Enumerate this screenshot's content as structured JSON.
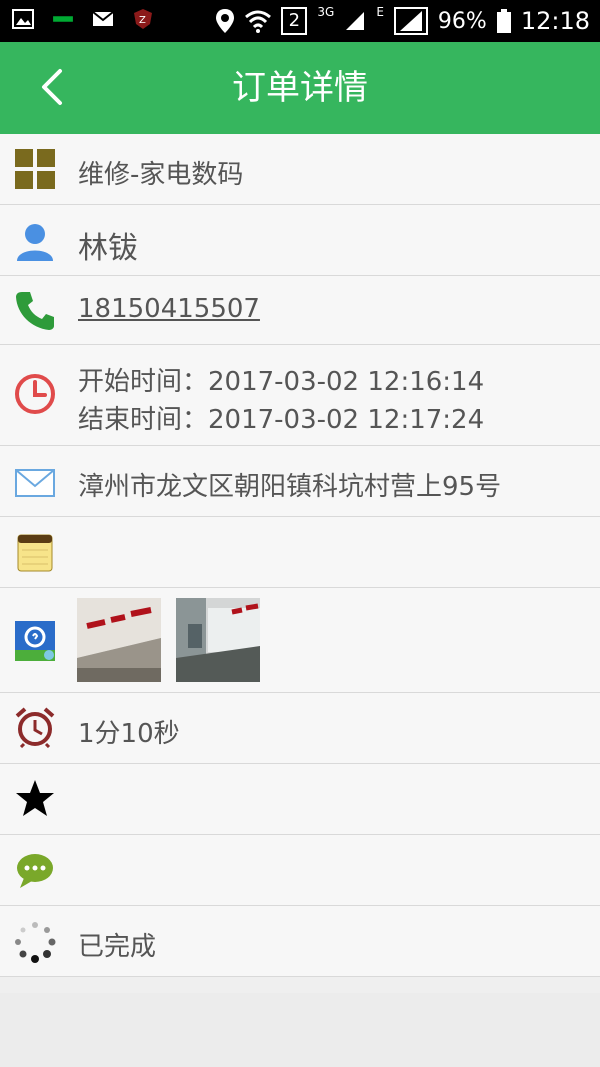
{
  "statusbar": {
    "battery": "96%",
    "time": "12:18",
    "network_3g": "3G",
    "network_e": "E",
    "sim_slot": "2"
  },
  "header": {
    "title": "订单详情"
  },
  "order": {
    "category": "维修-家电数码",
    "name": "林钹",
    "phone": "18150415507",
    "start_time": "开始时间：2017-03-02 12:16:14",
    "end_time": "结束时间：2017-03-02 12:17:24",
    "address": "漳州市龙文区朝阳镇科坑村营上95号",
    "note": "",
    "duration": "1分10秒",
    "rating": "",
    "comment": "",
    "status": "已完成"
  },
  "colors": {
    "appbar": "#36b65e",
    "phone_icon": "#2e9b3a",
    "clock_icon": "#e04b4b",
    "person_icon": "#4a90e2",
    "alarm_icon": "#8c2b2b"
  }
}
